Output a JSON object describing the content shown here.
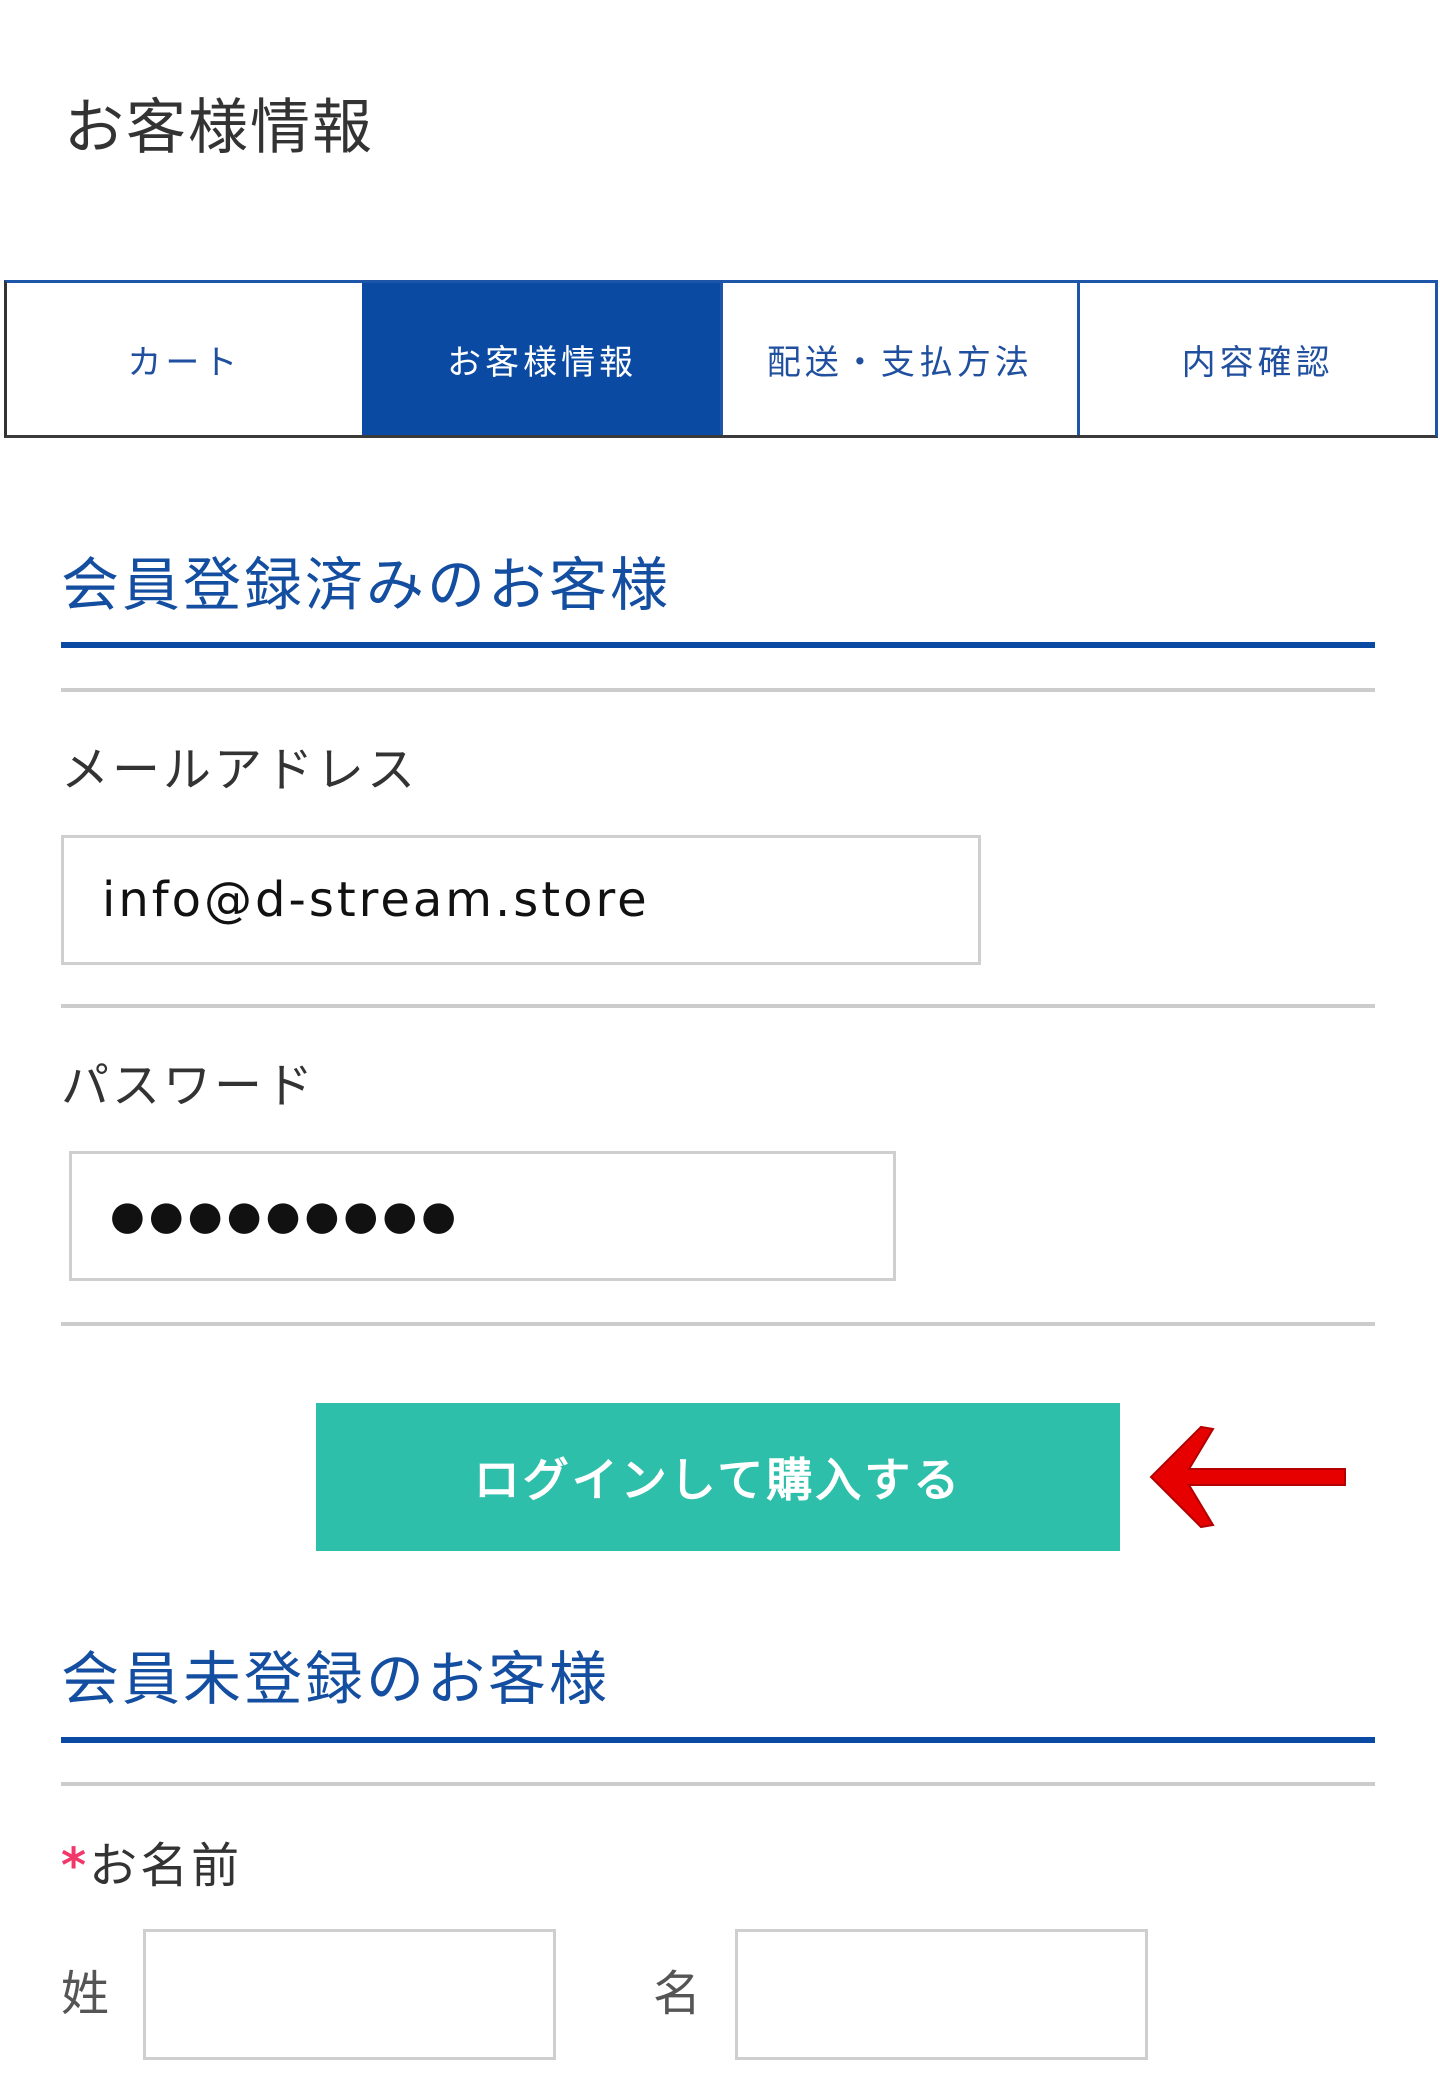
{
  "page": {
    "title": "お客様情報"
  },
  "steps": {
    "items": [
      {
        "label": "カート",
        "active": false
      },
      {
        "label": "お客様情報",
        "active": true
      },
      {
        "label": "配送・支払方法",
        "active": false
      },
      {
        "label": "内容確認",
        "active": false
      }
    ]
  },
  "member_section": {
    "heading": "会員登録済みのお客様",
    "email_label": "メールアドレス",
    "email_value": "info@d-stream.store",
    "password_label": "パスワード",
    "password_mask": "●●●●●●●●●",
    "login_button": "ログインして購入する",
    "annotation": "red-left-arrow-icon"
  },
  "guest_section": {
    "heading": "会員未登録のお客様",
    "required_mark": "*",
    "name_label": "お名前",
    "surname_label": "姓",
    "surname_value": "",
    "given_name_label": "名",
    "given_name_value": ""
  },
  "colors": {
    "primary_blue": "#0b4aa2",
    "button_teal": "#2dbfaa",
    "required_pink": "#f2386a",
    "annotation_red": "#e60000"
  }
}
